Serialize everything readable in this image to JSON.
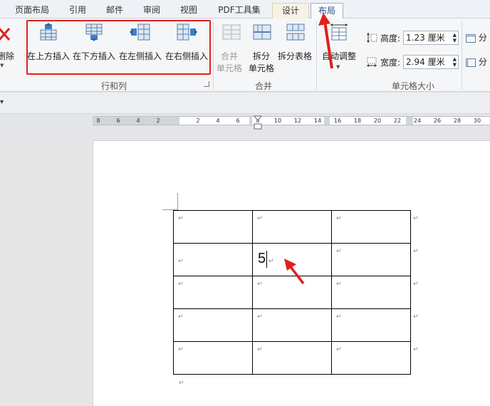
{
  "tabs": [
    {
      "label": "页面布局"
    },
    {
      "label": "引用"
    },
    {
      "label": "邮件"
    },
    {
      "label": "审阅"
    },
    {
      "label": "视图"
    },
    {
      "label": "PDF工具集"
    },
    {
      "label": "设计"
    },
    {
      "label": "布局"
    }
  ],
  "ribbon": {
    "delete_label": "删除",
    "rows_cols": {
      "insert_above": "在上方插入",
      "insert_below": "在下方插入",
      "insert_left": "在左侧插入",
      "insert_right": "在右侧插入",
      "group_label": "行和列"
    },
    "merge": {
      "merge_cells_1": "合并",
      "merge_cells_2": "单元格",
      "split_cells_1": "拆分",
      "split_cells_2": "单元格",
      "split_table": "拆分表格",
      "group_label": "合并"
    },
    "autofit": {
      "label": "自动调整"
    },
    "cell_size": {
      "height_label": "高度:",
      "height_value": "1.23 厘米",
      "width_label": "宽度:",
      "width_value": "2.94 厘米",
      "group_label": "单元格大小",
      "distribute_label": "分"
    }
  },
  "ruler": {
    "ticks": [
      "8",
      "6",
      "4",
      "2",
      "2",
      "4",
      "6",
      "8",
      "10",
      "12",
      "14",
      "16",
      "18",
      "20",
      "22",
      "24",
      "26",
      "28",
      "30"
    ]
  },
  "document": {
    "para_mark": "↵",
    "cell_text": "5"
  },
  "colors": {
    "highlight": "#e0201d",
    "accent": "#1e4e8c"
  }
}
